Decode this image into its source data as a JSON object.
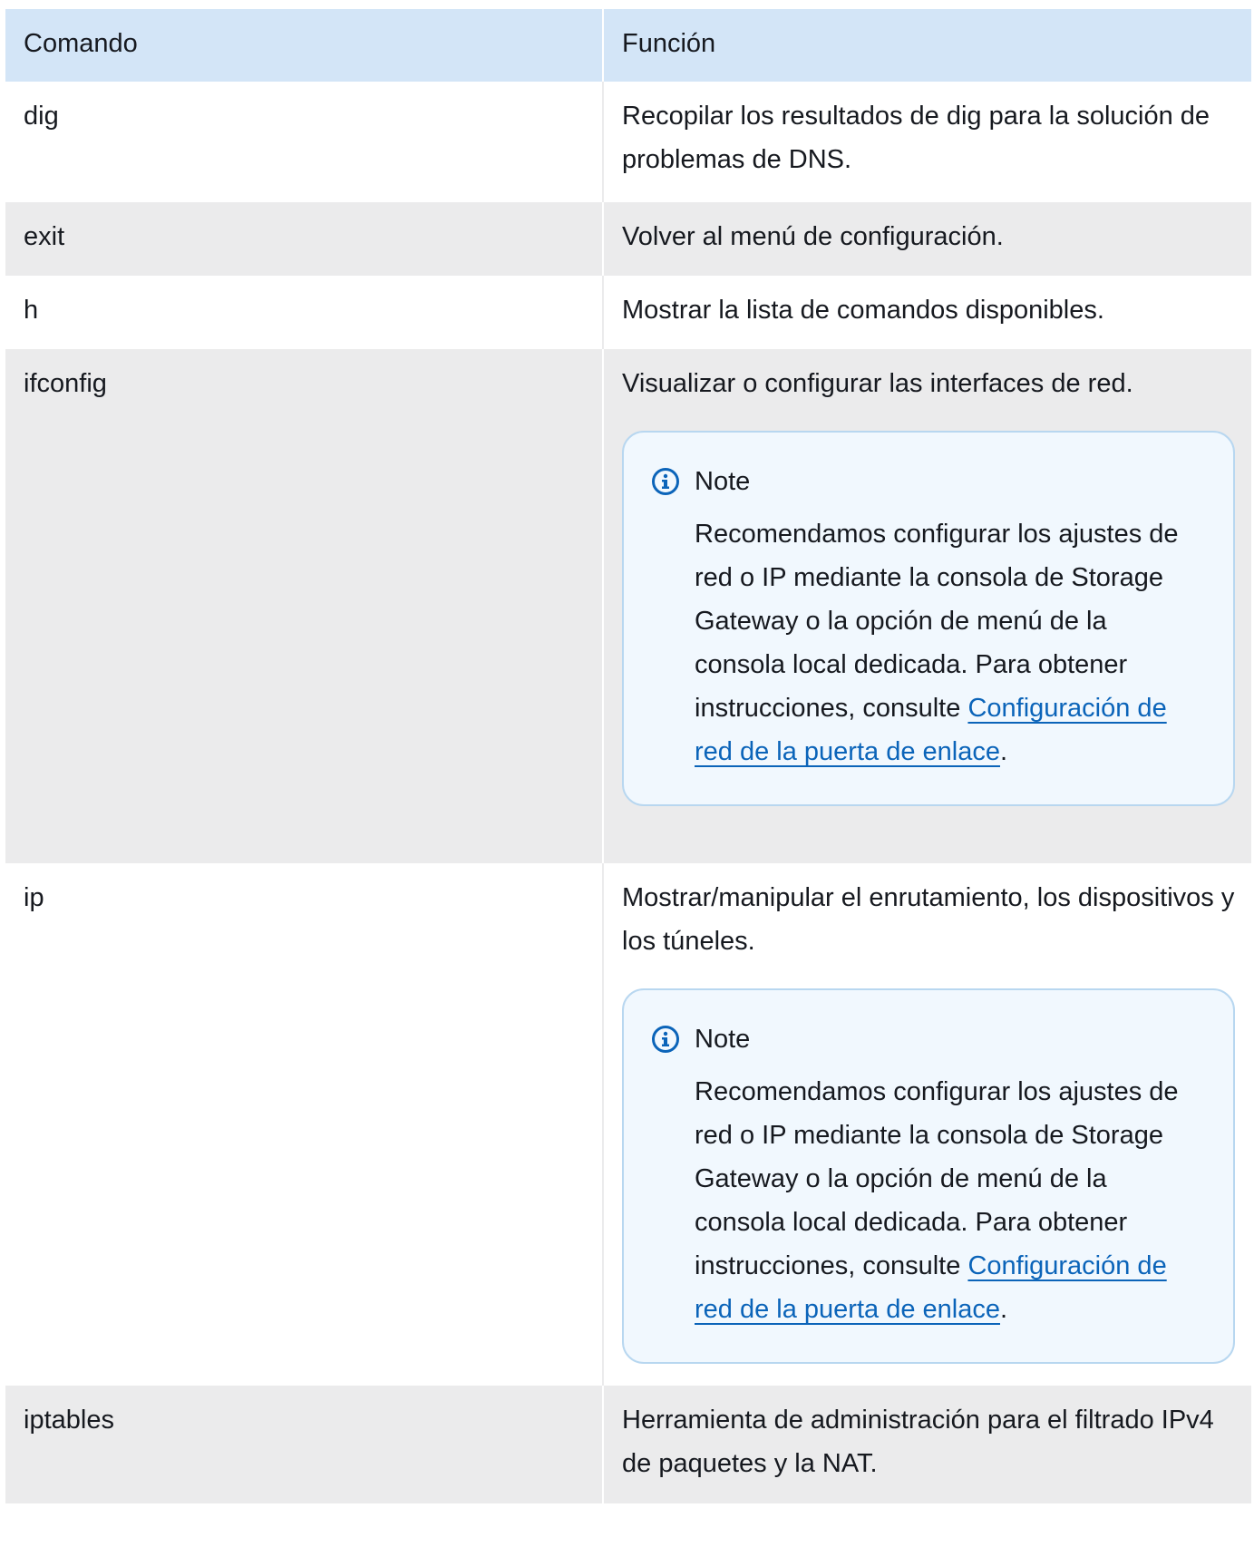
{
  "table": {
    "headers": [
      "Comando",
      "Función"
    ],
    "rows": [
      {
        "command": "dig",
        "function": "Recopilar los resultados de dig para la solución de problemas de DNS."
      },
      {
        "command": "exit",
        "function": "Volver al menú de configuración."
      },
      {
        "command": "h",
        "function": "Mostrar la lista de comandos disponibles."
      },
      {
        "command": "ifconfig",
        "function": "Visualizar o configurar las interfaces de red.",
        "note": {
          "icon": "info-icon",
          "title": "Note",
          "text": "Recomendamos configurar los ajustes de red o IP mediante la consola de Storage Gateway o la opción de menú de la consola local dedicada. Para obtener instrucciones, consulte ",
          "link": "Configuración de red de la puerta de enlace",
          "trailing": "."
        }
      },
      {
        "command": "ip",
        "function": "Mostrar/manipular el enrutamiento, los dispositivos y los túneles.",
        "note": {
          "icon": "info-icon",
          "title": "Note",
          "text": "Recomendamos configurar los ajustes de red o IP mediante la consola de Storage Gateway o la opción de menú de la consola local dedicada. Para obtener instrucciones, consulte ",
          "link": "Configuración de red de la puerta de enlace",
          "trailing": "."
        }
      },
      {
        "command": "iptables",
        "function": "Herramienta de administración para el filtrado IPv4 de paquetes y la NAT."
      }
    ]
  },
  "colors": {
    "header_bg": "#d3e5f7",
    "row_alt_bg": "#ebebec",
    "note_bg": "#f1f8fe",
    "note_border": "#b8d7f0",
    "link": "#0b64b9",
    "icon": "#0b64b9"
  }
}
